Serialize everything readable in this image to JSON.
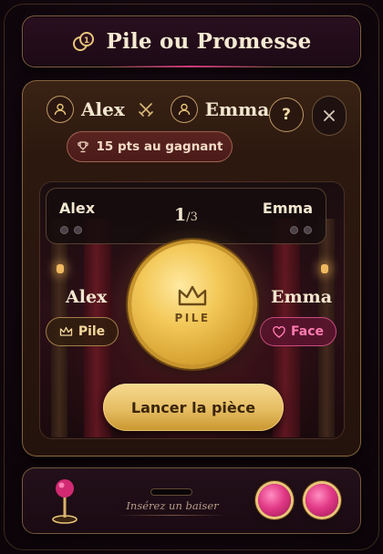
{
  "header": {
    "title": "Pile ou Promesse",
    "icon": "coins-icon"
  },
  "players": {
    "left": "Alex",
    "right": "Emma",
    "vs_icon": "crossed-swords-icon"
  },
  "controls": {
    "help_label": "?",
    "close_icon": "close-icon"
  },
  "prize": {
    "label": "15 pts au gagnant",
    "icon": "trophy-icon"
  },
  "scoreboard": {
    "left_name": "Alex",
    "right_name": "Emma",
    "round_current": "1",
    "round_total": "/3"
  },
  "choices": {
    "left_name": "Alex",
    "left_choice": "Pile",
    "right_name": "Emma",
    "right_choice": "Face"
  },
  "coin": {
    "label": "PILE",
    "icon": "crown-icon"
  },
  "action": {
    "launch_label": "Lancer la pièce"
  },
  "machine": {
    "slot_hint": "Insérez un baiser"
  },
  "colors": {
    "gold": "#e6bd63",
    "pink": "#e23a86",
    "background": "#12070e"
  }
}
